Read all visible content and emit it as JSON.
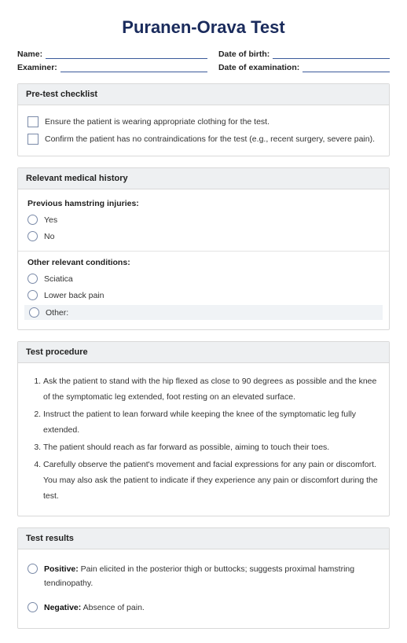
{
  "title": "Puranen-Orava Test",
  "meta": {
    "name_label": "Name:",
    "dob_label": "Date of birth:",
    "examiner_label": "Examiner:",
    "exam_date_label": "Date of examination:"
  },
  "pretest": {
    "header": "Pre-test checklist",
    "items": [
      "Ensure the patient is wearing appropriate clothing for the test.",
      "Confirm the patient has no contraindications for the test (e.g., recent surgery, severe pain)."
    ]
  },
  "history": {
    "header": "Relevant medical history",
    "prev_label": "Previous hamstring injuries:",
    "prev_options": [
      "Yes",
      "No"
    ],
    "other_label": "Other relevant conditions:",
    "other_options": [
      "Sciatica",
      "Lower back pain",
      "Other:"
    ]
  },
  "procedure": {
    "header": "Test procedure",
    "steps": [
      "Ask the patient to stand with the hip flexed as close to 90 degrees as possible and the knee of the symptomatic leg extended, foot resting on an elevated surface.",
      "Instruct the patient to lean forward while keeping the knee of the symptomatic leg fully extended.",
      "The patient should reach as far forward as possible, aiming to touch their toes.",
      "Carefully observe the patient's movement and facial expressions for any pain or discomfort. You may also ask the patient to indicate if they experience any pain or discomfort during the test."
    ]
  },
  "results": {
    "header": "Test results",
    "positive_label": "Positive:",
    "positive_text": " Pain elicited in the posterior thigh or buttocks; suggests proximal hamstring tendinopathy.",
    "negative_label": "Negative:",
    "negative_text": " Absence of pain."
  }
}
